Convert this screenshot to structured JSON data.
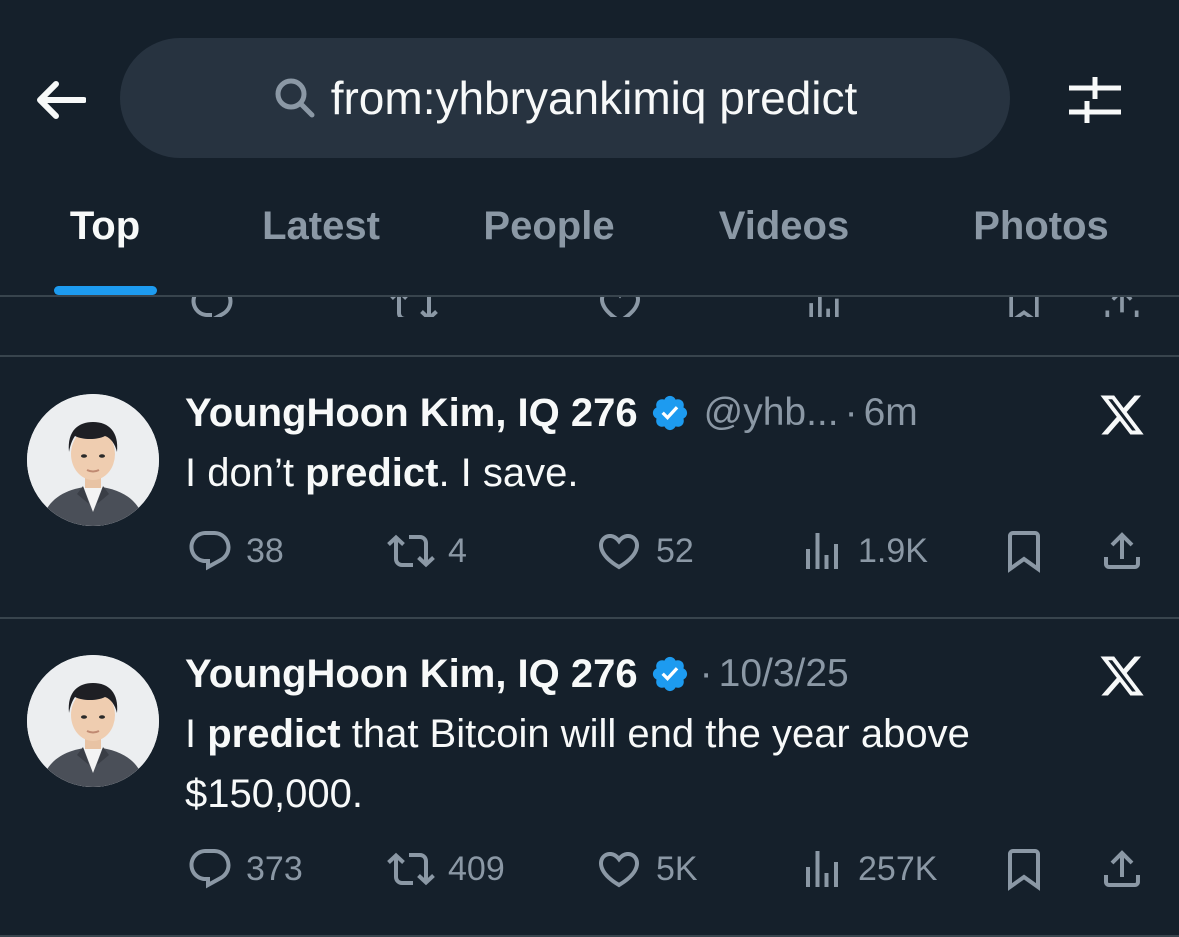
{
  "search": {
    "query": "from:yhbryankimiq predict"
  },
  "tabs": [
    {
      "label": "Top",
      "active": true
    },
    {
      "label": "Latest",
      "active": false
    },
    {
      "label": "People",
      "active": false
    },
    {
      "label": "Videos",
      "active": false
    },
    {
      "label": "Photos",
      "active": false
    }
  ],
  "icons": {
    "back": "back-arrow-icon",
    "search": "search-icon",
    "filter": "sliders-icon",
    "reply": "reply-icon",
    "repost": "repost-icon",
    "like": "heart-icon",
    "views": "views-icon",
    "bookmark": "bookmark-icon",
    "share": "share-icon",
    "verified": "verified-badge-icon",
    "x": "x-logo-icon"
  },
  "colors": {
    "background": "#15202b",
    "accent": "#1d9bf0",
    "muted": "#8b98a5"
  },
  "tweets": [
    {
      "author": "YoungHoon Kim, IQ 276",
      "handle": "@yhb...",
      "separator": "·",
      "time": "6m",
      "text_parts": [
        "I don’t ",
        "predict",
        ". I save."
      ],
      "replies": "38",
      "reposts": "4",
      "likes": "52",
      "views": "1.9K"
    },
    {
      "author": "YoungHoon Kim, IQ 276",
      "handle": "",
      "separator": "·",
      "time": "10/3/25",
      "text_parts": [
        "I ",
        "predict",
        " that Bitcoin will end the year above $150,000."
      ],
      "replies": "373",
      "reposts": "409",
      "likes": "5K",
      "views": "257K"
    }
  ]
}
